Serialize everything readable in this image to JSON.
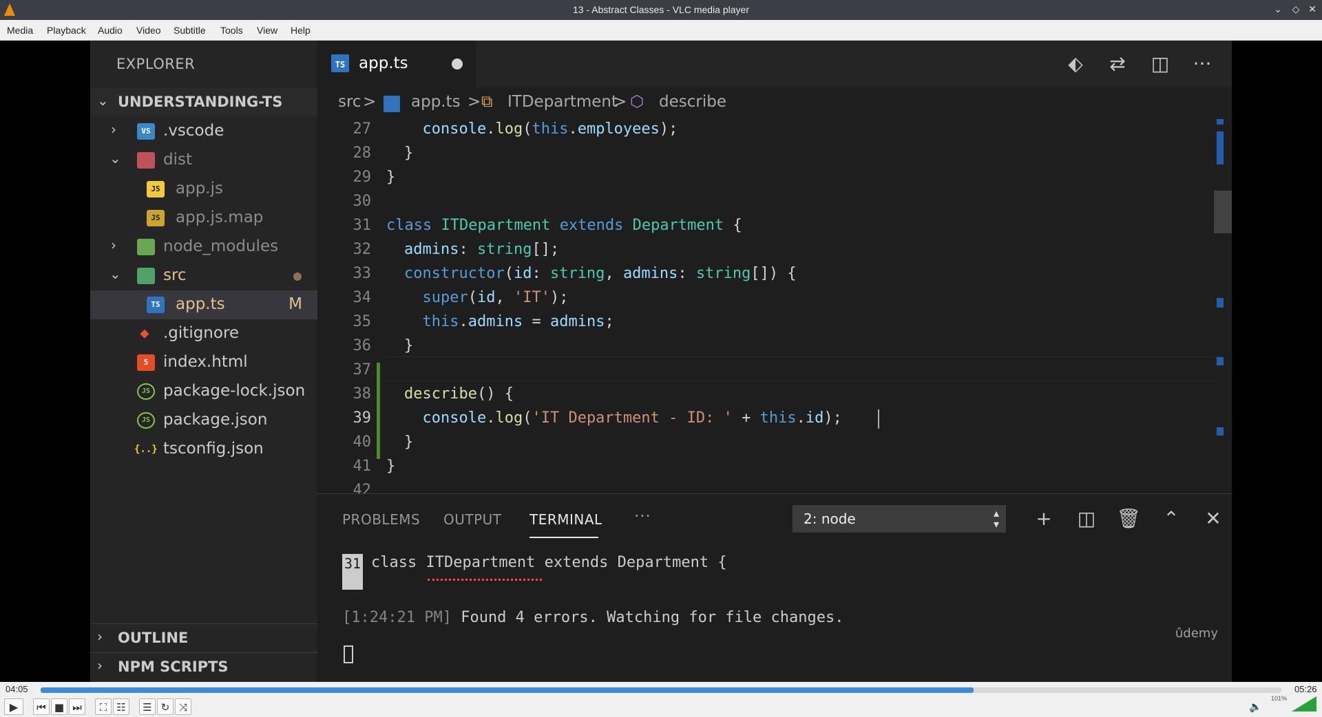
{
  "window": {
    "title": "13 - Abstract Classes - VLC media player",
    "minimize": "⌄",
    "restore": "◇",
    "close": "✕"
  },
  "menu": [
    "Media",
    "Playback",
    "Audio",
    "Video",
    "Subtitle",
    "Tools",
    "View",
    "Help"
  ],
  "explorer": {
    "title": "EXPLORER",
    "project": "UNDERSTANDING-TS",
    "items": [
      {
        "label": "vscode",
        "prefix": ".",
        "icon": "VS"
      },
      {
        "label": "dist"
      },
      {
        "label": "app.js",
        "icon": "JS"
      },
      {
        "label": "app.js.map",
        "icon": "JS"
      },
      {
        "label": "node_modules"
      },
      {
        "label": "src"
      },
      {
        "label": "app.ts",
        "icon": "TS",
        "badge": "M"
      },
      {
        "label": ".gitignore"
      },
      {
        "label": "index.html",
        "icon": "5"
      },
      {
        "label": "package-lock.json",
        "icon": "JS"
      },
      {
        "label": "package.json",
        "icon": "JS"
      },
      {
        "label": "tsconfig.json",
        "icon": "{..}"
      }
    ],
    "outline": "OUTLINE",
    "npm_scripts": "NPM SCRIPTS"
  },
  "editor": {
    "tab_label": "app.ts",
    "tab_icon": "TS",
    "breadcrumb": {
      "src": "src",
      "sep": ">",
      "file": "app.ts",
      "class": "ITDepartment",
      "method": "describe"
    },
    "current_line": 39
  },
  "panel": {
    "tabs": [
      "PROBLEMS",
      "OUTPUT",
      "TERMINAL"
    ],
    "more": "···",
    "terminal_select": "2: node",
    "terminal_line_no": "31",
    "terminal_code": "class ITDepartment extends Department {",
    "terminal_time": "[1:24:21 PM]",
    "terminal_msg": " Found 4 errors. Watching for file changes.",
    "watermark": "ûdemy"
  },
  "player": {
    "elapsed": "04:05",
    "total": "05:26",
    "progress": 0.752,
    "volume_pct": "101%",
    "volume": 1.01
  },
  "colors": {
    "accent": "#3c8ad9",
    "ts_blue": "#2f74c0",
    "js_yellow": "#f0cb3b"
  }
}
